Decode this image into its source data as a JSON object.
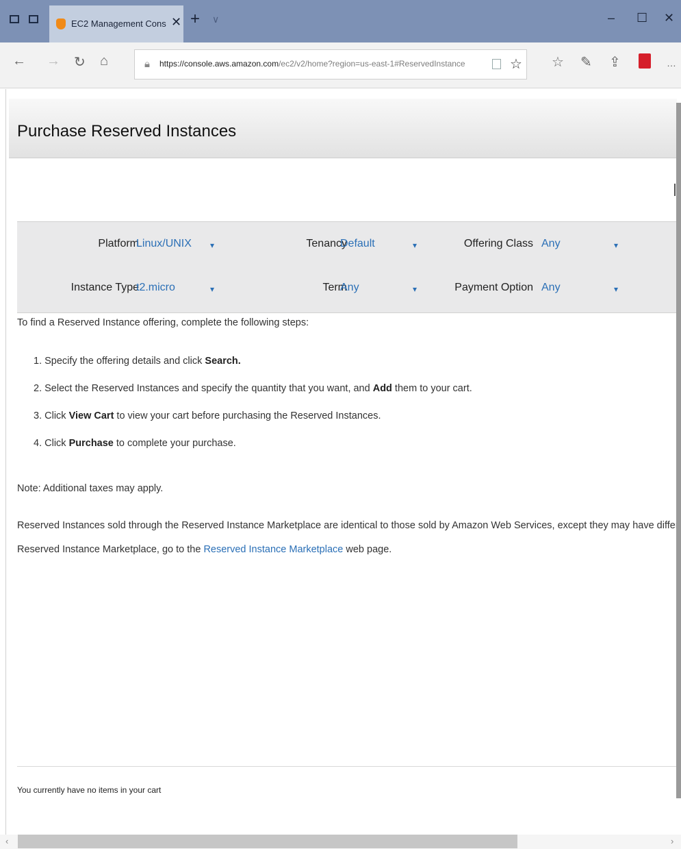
{
  "browser": {
    "tab_title": "EC2 Management Cons",
    "tab_close": "✕",
    "new_tab": "+",
    "tab_menu": "∨",
    "window_min": "–",
    "window_max": "☐",
    "window_close": "✕",
    "url_host": "https://console.aws.amazon.com",
    "url_path": "/ec2/v2/home?region=us-east-1#ReservedInstance"
  },
  "page": {
    "title": "Purchase Reserved Instances",
    "filters": {
      "platform_label": "Platform",
      "platform_value": "Linux/UNIX",
      "tenancy_label": "Tenancy",
      "tenancy_value": "Default",
      "offering_class_label": "Offering Class",
      "offering_class_value": "Any",
      "instance_type_label": "Instance Type",
      "instance_type_value": "t2.micro",
      "term_label": "Term",
      "term_value": "Any",
      "payment_option_label": "Payment Option",
      "payment_option_value": "Any"
    },
    "instructions": {
      "intro": "To find a Reserved Instance offering, complete the following steps:",
      "step1_a": "1.  Specify the offering details and click ",
      "step1_b": "Search.",
      "step2_a": "2.  Select the Reserved Instances and specify the quantity that you want, and ",
      "step2_b": "Add",
      "step2_c": " them to your cart.",
      "step3_a": "3.  Click ",
      "step3_b": "View Cart",
      "step3_c": " to view your cart before purchasing the Reserved Instances.",
      "step4_a": "4.  Click ",
      "step4_b": "Purchase",
      "step4_c": " to complete your purchase.",
      "note": "Note: Additional taxes may apply.",
      "market_line1": "Reserved Instances sold through the Reserved Instance Marketplace are identical to those sold by Amazon Web Services, except they may have different prices",
      "market_line2_a": "Reserved Instance Marketplace, go to the ",
      "market_link": "Reserved Instance Marketplace",
      "market_line2_b": " web page."
    },
    "cart_message": "You currently have no items in your cart"
  },
  "colors": {
    "titlebar": "#7d91b5",
    "link": "#2a6fb6",
    "filter_band": "#e9e9ea"
  }
}
